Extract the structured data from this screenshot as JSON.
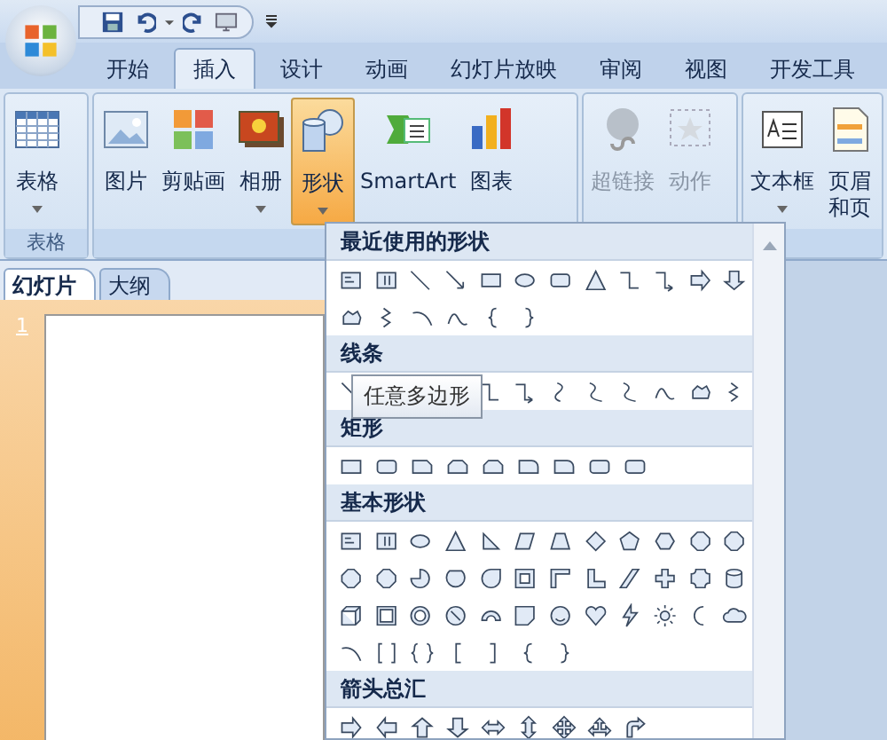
{
  "tabs": [
    {
      "label": "开始",
      "selected": false
    },
    {
      "label": "插入",
      "selected": true
    },
    {
      "label": "设计",
      "selected": false
    },
    {
      "label": "动画",
      "selected": false
    },
    {
      "label": "幻灯片放映",
      "selected": false
    },
    {
      "label": "审阅",
      "selected": false
    },
    {
      "label": "视图",
      "selected": false
    },
    {
      "label": "开发工具",
      "selected": false
    }
  ],
  "ribbon": {
    "groups": [
      {
        "label": "表格",
        "buttons": [
          {
            "kind": "table",
            "label": "表格",
            "dropdown": true,
            "pressed": false,
            "disabled": false
          }
        ]
      },
      {
        "buttons": [
          {
            "kind": "picture",
            "label": "图片",
            "dropdown": false,
            "pressed": false,
            "disabled": false
          },
          {
            "kind": "clipart",
            "label": "剪贴画",
            "dropdown": false,
            "pressed": false,
            "disabled": false
          },
          {
            "kind": "album",
            "label": "相册",
            "dropdown": true,
            "pressed": false,
            "disabled": false
          },
          {
            "kind": "shapes",
            "label": "形状",
            "dropdown": true,
            "pressed": true,
            "disabled": false
          },
          {
            "kind": "smartart",
            "label": "SmartArt",
            "dropdown": false,
            "pressed": false,
            "disabled": false
          },
          {
            "kind": "chart",
            "label": "图表",
            "dropdown": false,
            "pressed": false,
            "disabled": false
          }
        ]
      },
      {
        "buttons": [
          {
            "kind": "hyperlink",
            "label": "超链接",
            "dropdown": false,
            "pressed": false,
            "disabled": true
          },
          {
            "kind": "action",
            "label": "动作",
            "dropdown": false,
            "pressed": false,
            "disabled": true
          }
        ]
      },
      {
        "buttons": [
          {
            "kind": "textbox",
            "label": "文本框",
            "dropdown": true,
            "pressed": false,
            "disabled": false
          },
          {
            "kind": "header",
            "label": "页眉",
            "label_2": "和页",
            "dropdown": false,
            "pressed": false,
            "disabled": false
          }
        ]
      }
    ]
  },
  "slide_pane": {
    "tabs": [
      {
        "label": "幻灯片",
        "selected": true
      },
      {
        "label": "大纲",
        "selected": false
      }
    ],
    "slides": [
      {
        "number": "1",
        "selected": true
      }
    ]
  },
  "shapes_gallery": {
    "sections": [
      {
        "title": "最近使用的形状"
      },
      {
        "title": "线条"
      },
      {
        "title": "矩形"
      },
      {
        "title": "基本形状"
      },
      {
        "title": "箭头总汇"
      }
    ],
    "tooltip": "任意多边形"
  }
}
